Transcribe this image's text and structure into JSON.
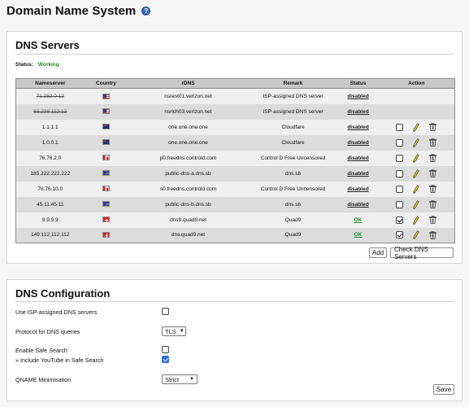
{
  "page": {
    "title": "Domain Name System",
    "help_icon": "?"
  },
  "dns_servers": {
    "title": "DNS Servers",
    "status_label": "Status:",
    "status_value": "Working",
    "columns": [
      "Nameserver",
      "Country",
      "rDNS",
      "Remark",
      "Status",
      "Action"
    ],
    "rows": [
      {
        "nameserver": "71.252.0.12",
        "country": "us",
        "rdns": "nsrest01.verizon.net",
        "remark": "ISP-assigned DNS server",
        "status": "disabled",
        "struck": true,
        "has_actions": false
      },
      {
        "nameserver": "68.238.112.12",
        "country": "us",
        "rdns": "nsrich03.verizon.net",
        "remark": "ISP-assigned DNS server",
        "status": "disabled",
        "struck": true,
        "has_actions": false
      },
      {
        "nameserver": "1.1.1.1",
        "country": "au",
        "rdns": "one.one.one.one",
        "remark": "Cloudfare",
        "status": "disabled",
        "struck": false,
        "has_actions": true,
        "enabled": false
      },
      {
        "nameserver": "1.0.0.1",
        "country": "au",
        "rdns": "one.one.one.one",
        "remark": "Cloudfare",
        "status": "disabled",
        "struck": false,
        "has_actions": true,
        "enabled": false
      },
      {
        "nameserver": "76.76.2.0",
        "country": "ca",
        "rdns": "p0.freedns.controld.com",
        "remark": "Control D Free Uncensored",
        "status": "disabled",
        "struck": false,
        "has_actions": true,
        "enabled": false
      },
      {
        "nameserver": "185.222.222.222",
        "country": "eu",
        "rdns": "public-dns-a.dns.sb",
        "remark": "dns.sb",
        "status": "disabled",
        "struck": false,
        "has_actions": true,
        "enabled": false
      },
      {
        "nameserver": "76.76.10.0",
        "country": "ca",
        "rdns": "s0.freedns.controld.com",
        "remark": "Control D Free Uncensored",
        "status": "disabled",
        "struck": false,
        "has_actions": true,
        "enabled": false
      },
      {
        "nameserver": "45.11.45.11",
        "country": "eu",
        "rdns": "public-dns-b.dns.sb",
        "remark": "dns.sb",
        "status": "disabled",
        "struck": false,
        "has_actions": true,
        "enabled": false
      },
      {
        "nameserver": "9.9.9.9",
        "country": "ch",
        "rdns": "dns9.quad9.net",
        "remark": "Quad9",
        "status": "OK",
        "struck": false,
        "has_actions": true,
        "enabled": true
      },
      {
        "nameserver": "149.112.112.112",
        "country": "ch",
        "rdns": "dns.quad9.net",
        "remark": "Quad9",
        "status": "OK",
        "struck": false,
        "has_actions": true,
        "enabled": true
      }
    ],
    "add_button": "Add",
    "check_button": "Check DNS Servers"
  },
  "dns_config": {
    "title": "DNS Configuration",
    "use_isp_label": "Use ISP-assigned DNS servers",
    "use_isp_checked": false,
    "protocol_label": "Protocol for DNS queries",
    "protocol_value": "TLS",
    "safe_search_label": "Enable Safe Search",
    "safe_search_checked": false,
    "youtube_label": "» Include YouTube in Safe Search",
    "youtube_checked": true,
    "qname_label": "QNAME Minimisation",
    "qname_value": "Strict",
    "save_button": "Save"
  },
  "colors": {
    "ok": "#1f8a1f",
    "header_bg": "#c8c8c8",
    "checkbox_blue": "#2d6bd6"
  }
}
